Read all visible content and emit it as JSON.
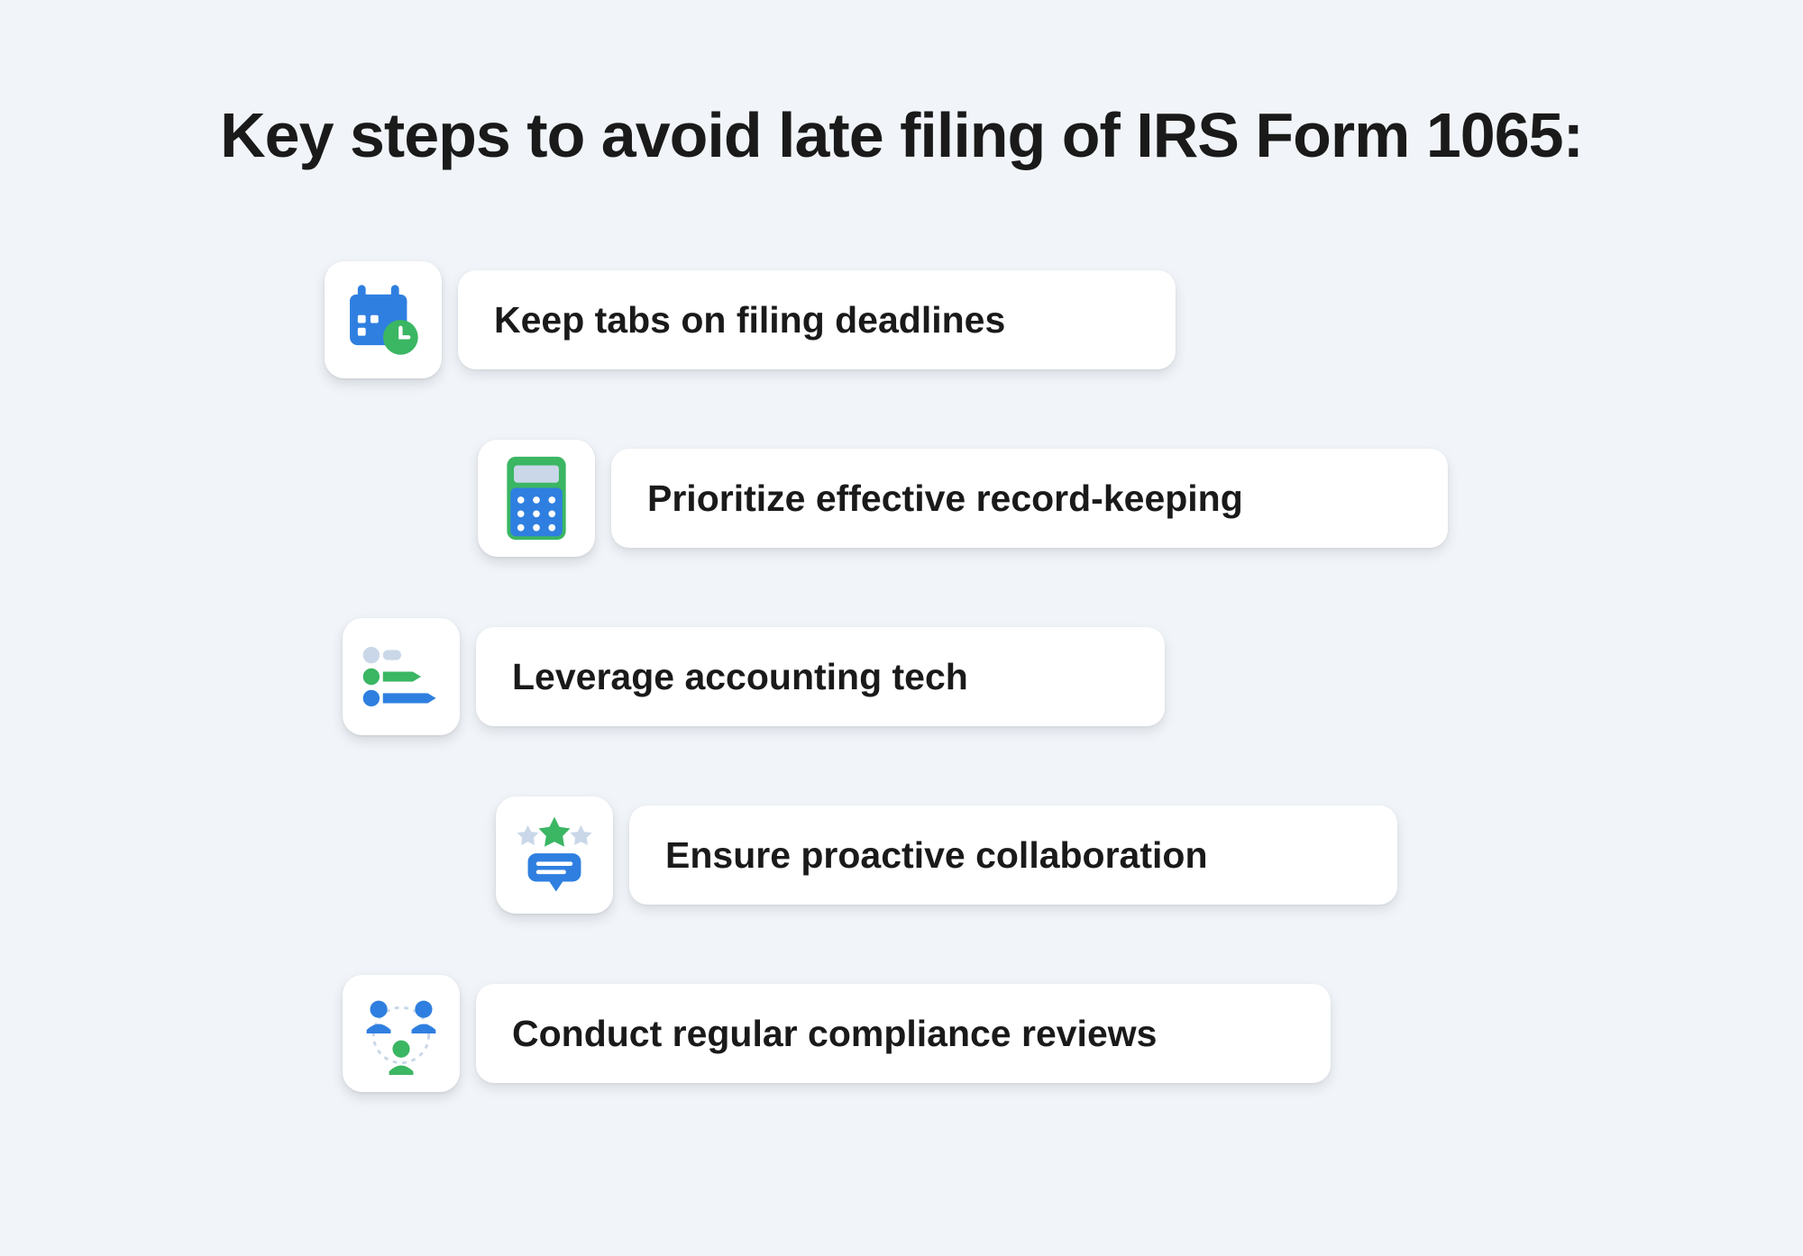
{
  "title": "Key steps to avoid late filing of IRS Form 1065:",
  "steps": [
    {
      "icon": "calendar-clock-icon",
      "label": "Keep tabs on filing deadlines"
    },
    {
      "icon": "calculator-icon",
      "label": "Prioritize effective record-keeping"
    },
    {
      "icon": "bars-progress-icon",
      "label": "Leverage accounting tech"
    },
    {
      "icon": "feedback-stars-icon",
      "label": "Ensure proactive collaboration"
    },
    {
      "icon": "team-review-icon",
      "label": "Conduct regular compliance reviews"
    }
  ],
  "colors": {
    "blue": "#2f7fe0",
    "green": "#3bb663",
    "light": "#c9d7e8"
  }
}
